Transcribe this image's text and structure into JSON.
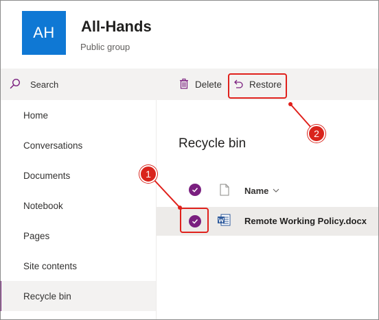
{
  "header": {
    "avatar_initials": "AH",
    "title": "All-Hands",
    "subtitle": "Public group"
  },
  "command_bar": {
    "search_label": "Search",
    "delete_label": "Delete",
    "restore_label": "Restore"
  },
  "nav": {
    "items": [
      {
        "label": "Home"
      },
      {
        "label": "Conversations"
      },
      {
        "label": "Documents"
      },
      {
        "label": "Notebook"
      },
      {
        "label": "Pages"
      },
      {
        "label": "Site contents"
      },
      {
        "label": "Recycle bin",
        "active": true
      }
    ]
  },
  "main": {
    "title": "Recycle bin",
    "columns": {
      "name": "Name"
    },
    "rows": [
      {
        "name": "Remote Working Policy.docx",
        "selected": true,
        "type": "word"
      }
    ]
  },
  "annotations": {
    "badge_1": "1",
    "badge_2": "2"
  },
  "colors": {
    "accent": "#7a1f7f",
    "avatar": "#0f78d4",
    "annotation": "#e0201b",
    "word": "#2b579a"
  }
}
